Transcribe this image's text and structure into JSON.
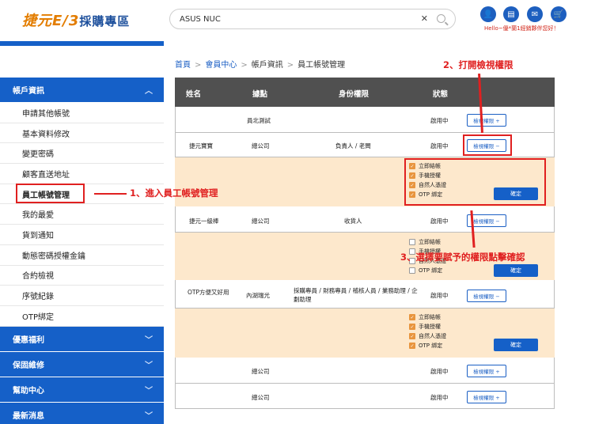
{
  "header": {
    "logo_text": "捷元",
    "logo_mark": "E/3",
    "logo_sub": "採購專區",
    "search_value": "ASUS NUC",
    "greeting": "Hello~優*蘭1經銷夥伴您好！"
  },
  "breadcrumb": [
    "首頁",
    "會員中心",
    "帳戶資訊",
    "員工帳號管理"
  ],
  "sidebar": {
    "account_section": "帳戶資訊",
    "items": [
      "申請其他帳號",
      "基本資料修改",
      "變更密碼",
      "顧客直送地址",
      "員工帳號管理",
      "我的最愛",
      "貨到通知",
      "動態密碼授權金鑰",
      "合約檢視",
      "序號紀錄",
      "OTP綁定"
    ],
    "sections": [
      "優惠福利",
      "保固維修",
      "幫助中心",
      "最新消息"
    ]
  },
  "table": {
    "headers": [
      "姓名",
      "據點",
      "身份權限",
      "狀態"
    ],
    "rows": [
      {
        "name": "",
        "site": "員北測試",
        "role": "",
        "status": "啟用中",
        "button": "檢視權限 +"
      },
      {
        "name": "捷元寶寶",
        "site": "總公司",
        "role": "負責人 / 老闆",
        "status": "啟用中",
        "button": "檢視權限 −"
      },
      {
        "name": "捷元一級棒",
        "site": "總公司",
        "role": "收貨人",
        "status": "啟用中",
        "button": "檢視權限 −"
      },
      {
        "name": "OTP方便又好用",
        "site": "內湖瑞光",
        "role": "採購專員 / 財務專員 / 稽核人員 / 業務助理 / 企劃助理",
        "status": "啟用中",
        "button": "檢視權限 −"
      },
      {
        "name": "",
        "site": "總公司",
        "role": "",
        "status": "啟用中",
        "button": "檢視權限 +"
      },
      {
        "name": "",
        "site": "總公司",
        "role": "",
        "status": "啟用中",
        "button": "檢視權限 +"
      }
    ],
    "permissions": [
      "立即結帳",
      "手機授權",
      "自然人憑證",
      "OTP 綁定"
    ],
    "perm_states": [
      [
        true,
        true,
        true,
        true
      ],
      [
        false,
        false,
        false,
        false
      ],
      [
        true,
        true,
        true,
        true
      ]
    ],
    "confirm": "確定"
  },
  "annotations": {
    "step1": "1、進入員工帳號管理",
    "step2": "2、打開檢視權限",
    "step3": "3、選擇要賦予的權限點擊確認"
  }
}
